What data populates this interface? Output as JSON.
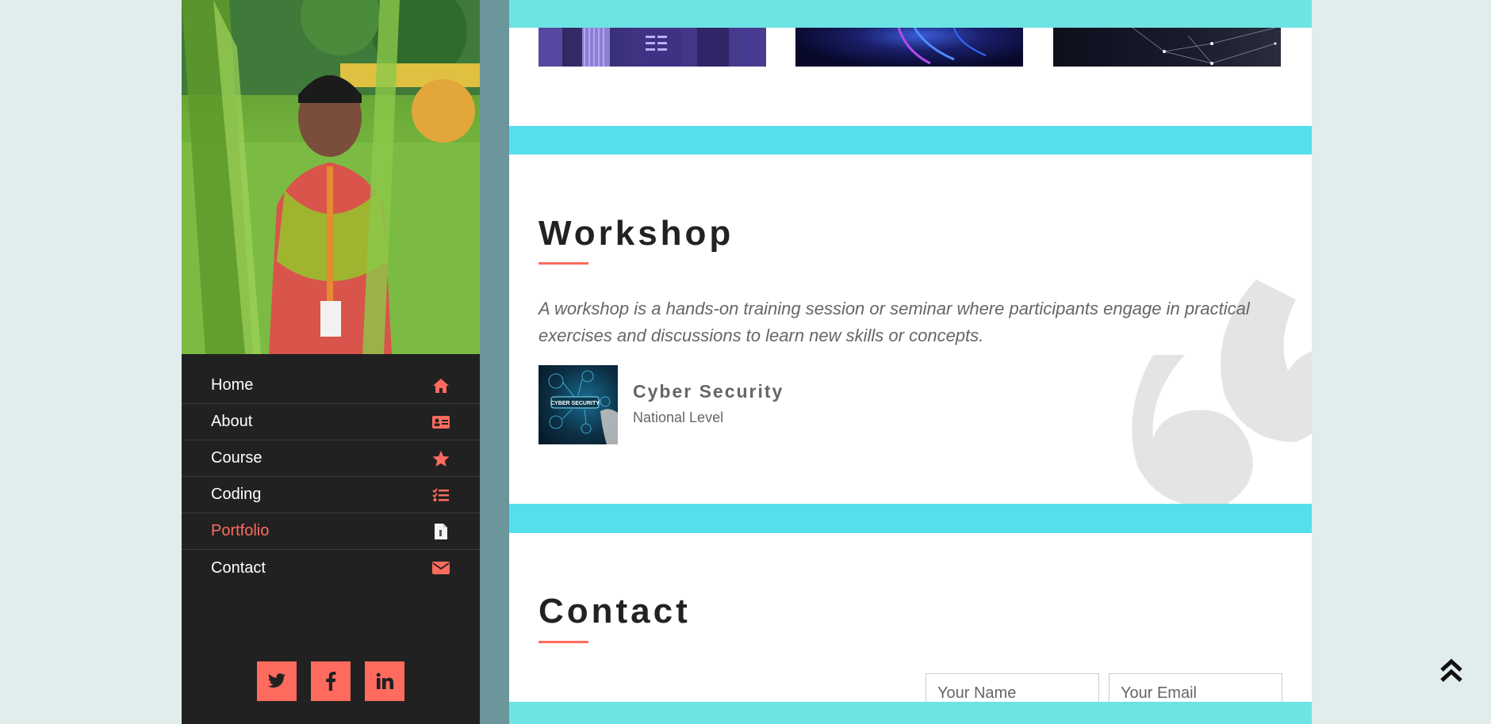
{
  "sidebar": {
    "nav": [
      {
        "label": "Home",
        "icon": "home-icon"
      },
      {
        "label": "About",
        "icon": "id-card-icon"
      },
      {
        "label": "Course",
        "icon": "star-icon"
      },
      {
        "label": "Coding",
        "icon": "tasks-icon"
      },
      {
        "label": "Portfolio",
        "icon": "file-icon",
        "active": true
      },
      {
        "label": "Contact",
        "icon": "envelope-icon"
      }
    ],
    "social": [
      "twitter-icon",
      "facebook-icon",
      "linkedin-icon"
    ]
  },
  "workshop": {
    "title": "Workshop",
    "description": "A workshop is a hands-on training session or seminar where participants engage in practical exercises and discussions to learn new skills or concepts.",
    "items": [
      {
        "title": "Cyber Security",
        "subtitle": "National Level",
        "image_text": "CYBER SECURITY"
      }
    ]
  },
  "contact": {
    "title": "Contact",
    "name_placeholder": "Your Name",
    "email_placeholder": "Your Email"
  },
  "colors": {
    "accent": "#ff6b5e",
    "sidebar_bg": "#212121",
    "cyan_bar": "#55dfeb",
    "page_bg": "#e1ecec"
  }
}
